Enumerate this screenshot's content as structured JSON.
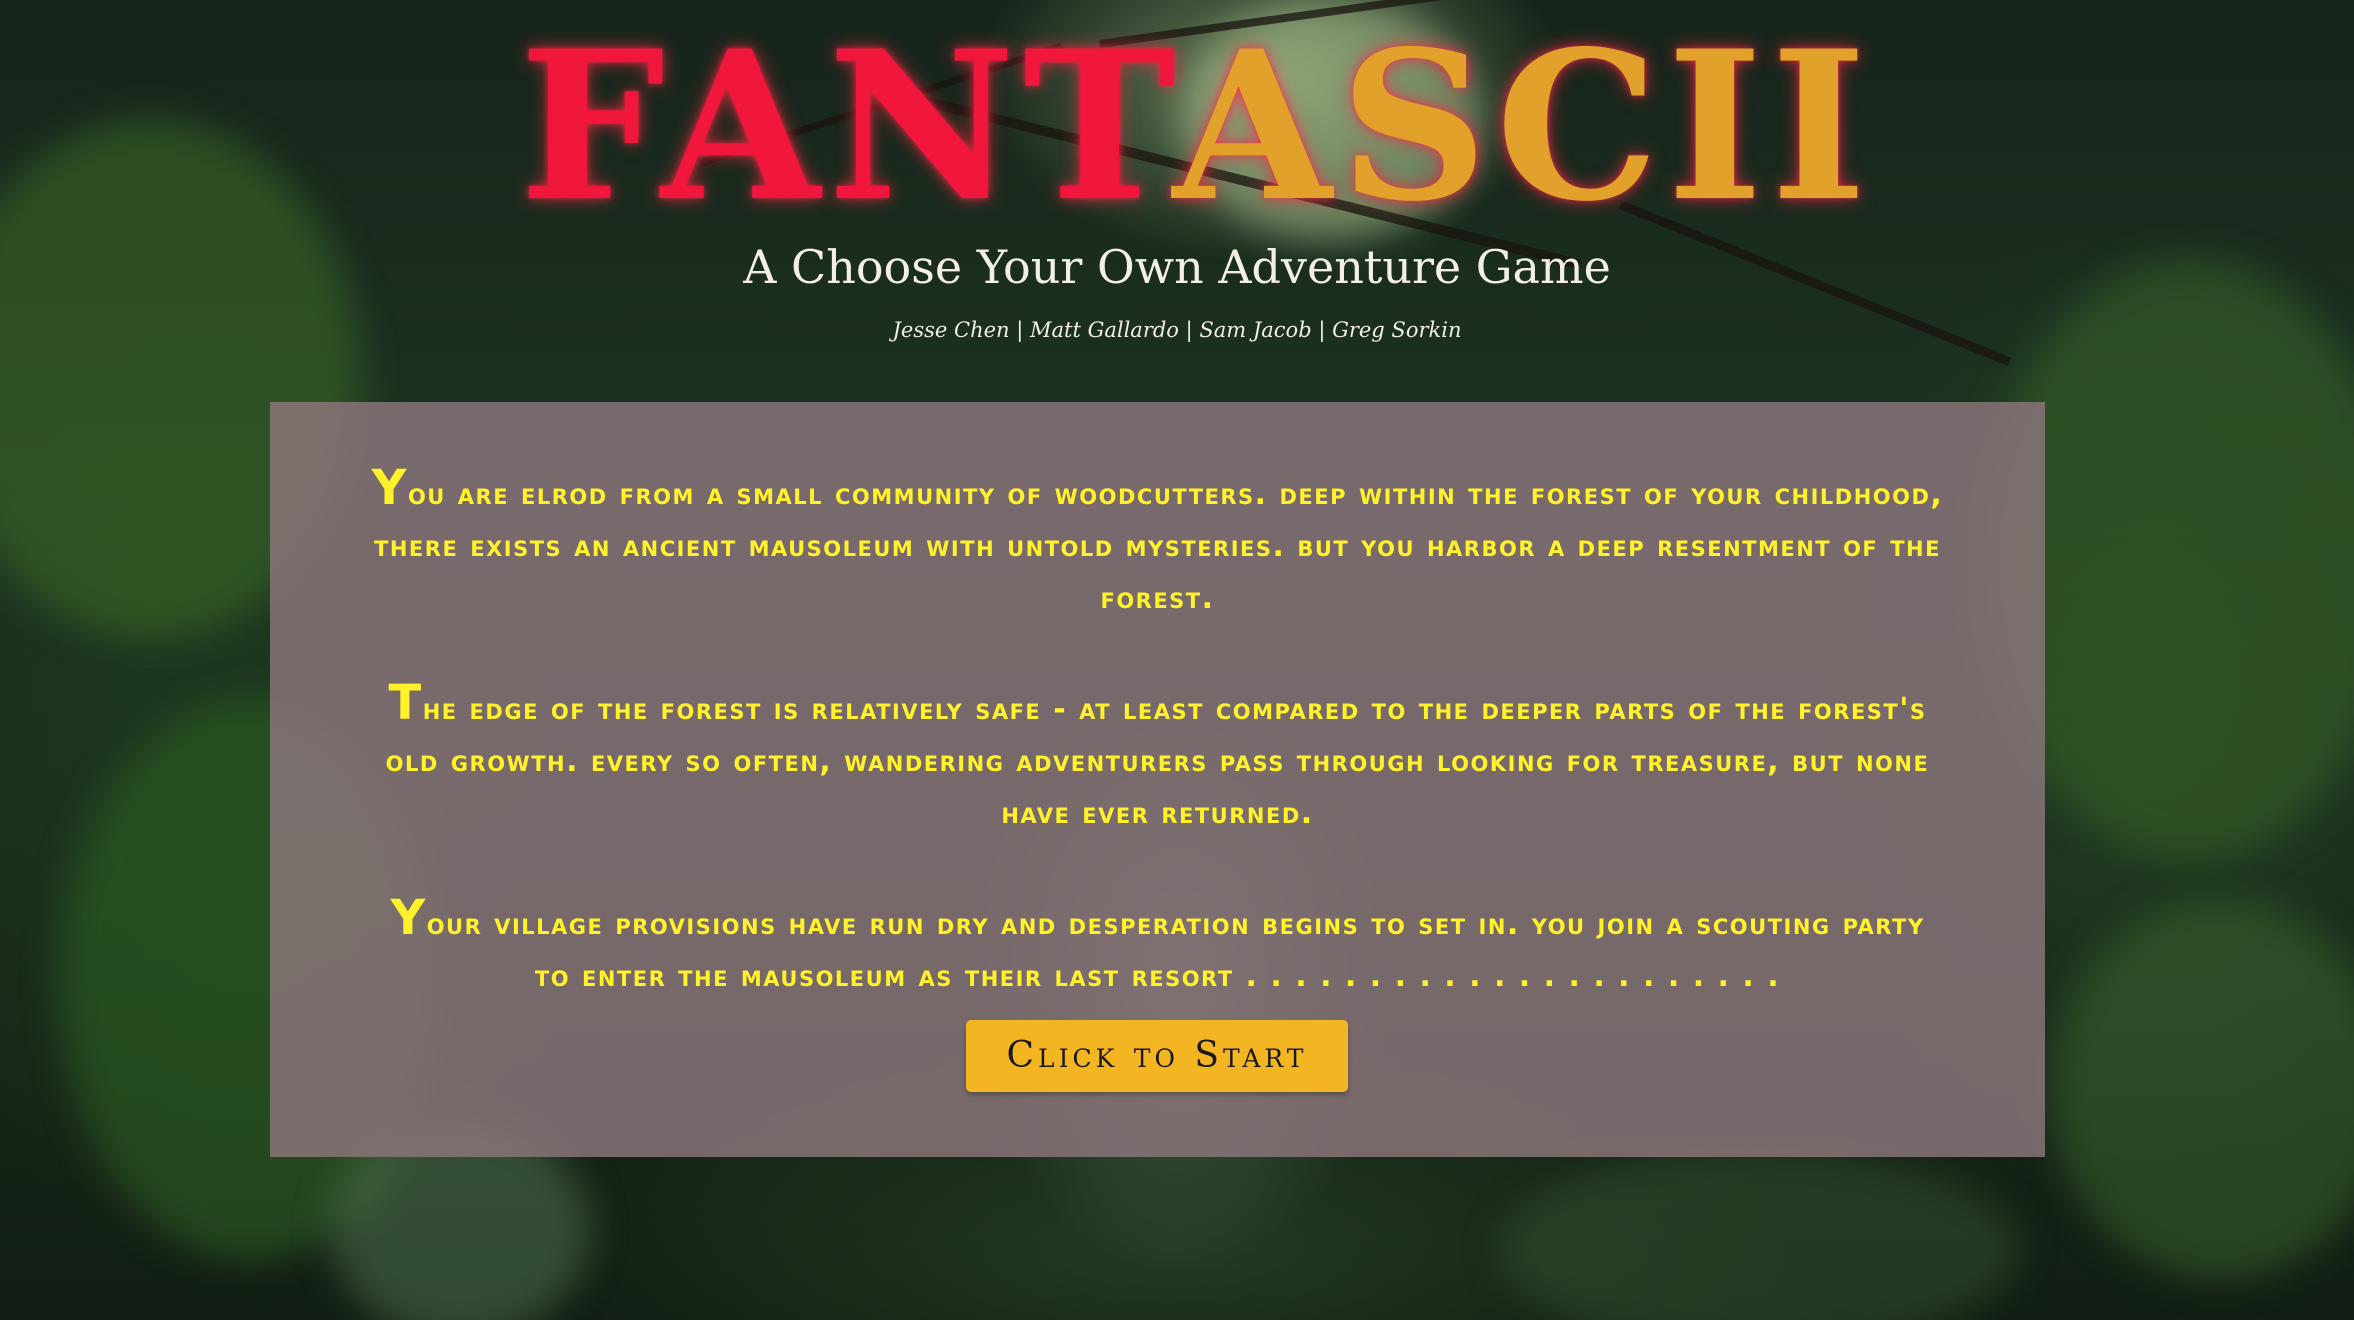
{
  "header": {
    "title_part_a": "FANT",
    "title_part_b": "ASCII",
    "subtitle": "A Choose Your Own Adventure Game",
    "credits": "Jesse Chen | Matt Gallardo | Sam Jacob | Greg Sorkin"
  },
  "story": {
    "paragraphs": [
      "You are Elrod from a small community of woodcutters. Deep within the forest of your childhood, there exists an ancient mausoleum with untold mysteries. But you harbor a deep resentment of the forest.",
      "The edge of the forest is relatively safe - at least compared to the deeper parts of the forest's old growth. Every so often, wandering adventurers pass through looking for treasure, but none have ever returned.",
      "Your village provisions have run dry and desperation begins to set in. You join a scouting party to enter the mausoleum as their last resort . . . . . . . . . . . . . . . . . . . . . ."
    ]
  },
  "actions": {
    "start_label": "Click to Start"
  },
  "colors": {
    "title_red": "#f0163c",
    "title_gold": "#e2a12b",
    "story_text": "#fff22a",
    "button_bg": "#f4b523",
    "panel_bg": "#8c767c"
  }
}
